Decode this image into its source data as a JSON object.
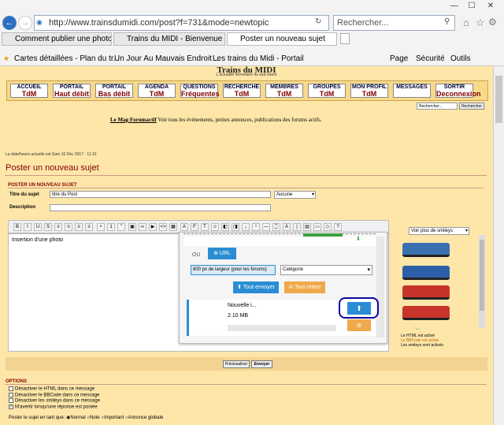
{
  "browser": {
    "url": "http://www.trainsdumidi.com/post?f=731&mode=newtopic",
    "search_placeholder": "Rechercher...",
    "tabs": [
      {
        "label": "Comment publier une photo sur..."
      },
      {
        "label": "Trains du MIDI - Bienvenue sur v..."
      },
      {
        "label": "Poster un nouveau sujet"
      }
    ],
    "favorites": [
      "Cartes détaillées - Plan du tr...",
      "Un Jour Au Mauvais Endroit ...",
      "Les trains du Midi - Portail"
    ],
    "commands": {
      "page": "Page",
      "security": "Sécurité",
      "tools": "Outils"
    }
  },
  "site": {
    "title": "Trains du MIDI",
    "subtitle": "L'actualité ferroviaire du sud-ouest",
    "nav": [
      {
        "top": "ACCUEIL",
        "sub": "TdM"
      },
      {
        "top": "PORTAIL",
        "sub": "Haut débit"
      },
      {
        "top": "PORTAIL",
        "sub": "Bas débit"
      },
      {
        "top": "AGENDA",
        "sub": "TdM"
      },
      {
        "top": "QUESTIONS",
        "sub": "Fréquentes"
      },
      {
        "top": "RECHERCHE",
        "sub": "TdM"
      },
      {
        "top": "MEMBRES",
        "sub": "TdM"
      },
      {
        "top": "GROUPES",
        "sub": "TdM"
      },
      {
        "top": "MON PROFIL",
        "sub": "TdM"
      },
      {
        "top": "MESSAGES",
        "sub": ""
      },
      {
        "top": "SORTIR",
        "sub": "Deconnexion"
      }
    ],
    "search_placeholder": "Rechercher...",
    "search_button": "Rechercher",
    "mag_link": "Le Mag Forumactif",
    "mag_text": "Voir tous les événements, petites annonces, publications des forums actifs.",
    "datetime": "La date/heure actuelle est Sam 16 Déc 2017 - 11:16"
  },
  "post": {
    "heading": "Poster un nouveau sujet",
    "section": "POSTER UN NOUVEAU SUJET",
    "subject_label": "Titre du sujet",
    "subject_value": "titre du Post",
    "type_select": "Aucune",
    "description_label": "Description",
    "description_value": "",
    "editor_text": "Insertion d'une photo",
    "smileys_select": "Voir plus de smileys",
    "html_status": "Le HTML est activé",
    "bbcode_status": "Le BBCode est activé",
    "smileys_status": "Les smileys sont activés",
    "preview_button": "Prévisualiser",
    "send_button": "Envoyer"
  },
  "upload": {
    "or_label": "OU",
    "url_button": "URL",
    "size_select": "800 px de largeur (pour les forums)",
    "category_select": "Catégorie",
    "send_all": "Tout envoyer",
    "remove_all": "Tout retirer",
    "file_name": "Nouvelle i...",
    "file_size": "2.10 MB"
  },
  "options": {
    "heading": "OPTIONS",
    "items": [
      "Désactiver le HTML dans ce message",
      "Désactiver le BBCode dans ce message",
      "Désactiver les smileys dans ce message",
      "M'avertir lorsqu'une réponse est postée"
    ],
    "post_as_label": "Poster le sujet en tant que:",
    "radios": [
      "Normal",
      "Note",
      "Important",
      "Annonce globale"
    ]
  },
  "colors": {
    "page_bg": "#fee6a9",
    "accent": "#800000",
    "blue": "#2a8dd4",
    "orange": "#efa94a"
  }
}
